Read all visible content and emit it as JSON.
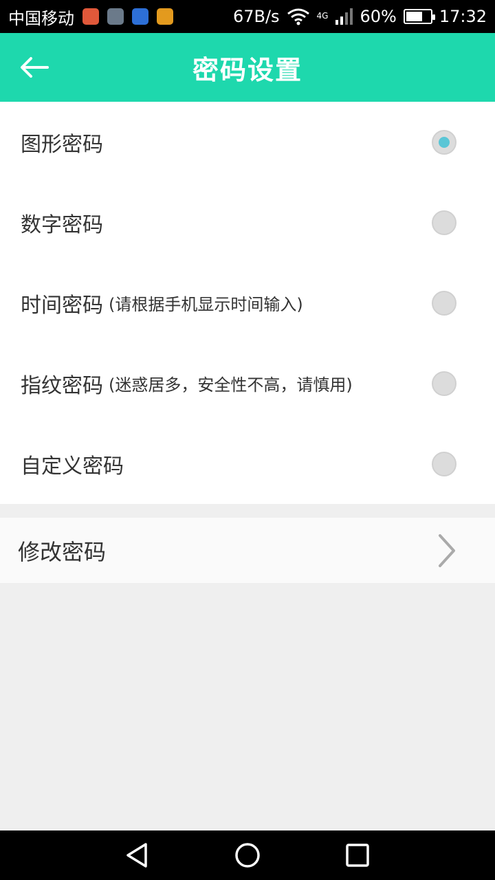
{
  "status_bar": {
    "carrier": "中国移动",
    "network_speed": "67B/s",
    "network_type": "4G",
    "battery": "60%",
    "time": "17:32",
    "icons": [
      "message-app-icon",
      "gallery-app-icon",
      "cloud-app-icon",
      "office-app-icon",
      "wifi-icon",
      "signal-icon",
      "battery-icon"
    ],
    "colors": {
      "app1": "#e0583a",
      "app2": "#6b7a8a",
      "app3": "#2d6fd6",
      "app4": "#e39a1e"
    }
  },
  "app_bar": {
    "title": "密码设置",
    "back_icon": "back-arrow-icon",
    "color": "#1ed8ad"
  },
  "options": [
    {
      "title": "图形密码",
      "note": "",
      "selected": true
    },
    {
      "title": "数字密码",
      "note": "",
      "selected": false
    },
    {
      "title": "时间密码",
      "note": "(请根据手机显示时间输入)",
      "selected": false
    },
    {
      "title": "指纹密码",
      "note": "(迷惑居多，安全性不高，请慎用)",
      "selected": false
    },
    {
      "title": "自定义密码",
      "note": "",
      "selected": false
    }
  ],
  "change_password": {
    "title": "修改密码",
    "icon": "chevron-right-icon"
  },
  "nav_bar": {
    "icons": [
      "back-icon",
      "home-icon",
      "recents-icon"
    ]
  },
  "colors": {
    "accent": "#1ed8ad",
    "radio_selected": "#5ac6d6",
    "radio_unselected": "#dcdcdc"
  }
}
